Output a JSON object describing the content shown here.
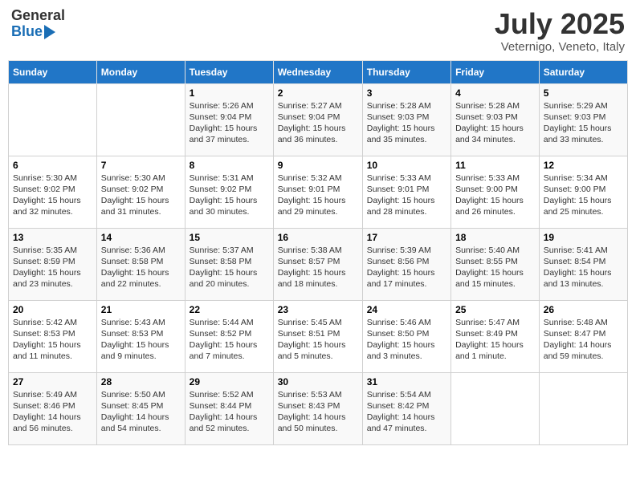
{
  "header": {
    "logo_general": "General",
    "logo_blue": "Blue",
    "month": "July 2025",
    "location": "Veternigo, Veneto, Italy"
  },
  "days_of_week": [
    "Sunday",
    "Monday",
    "Tuesday",
    "Wednesday",
    "Thursday",
    "Friday",
    "Saturday"
  ],
  "weeks": [
    [
      {
        "day": "",
        "info": ""
      },
      {
        "day": "",
        "info": ""
      },
      {
        "day": "1",
        "sunrise": "Sunrise: 5:26 AM",
        "sunset": "Sunset: 9:04 PM",
        "daylight": "Daylight: 15 hours and 37 minutes."
      },
      {
        "day": "2",
        "sunrise": "Sunrise: 5:27 AM",
        "sunset": "Sunset: 9:04 PM",
        "daylight": "Daylight: 15 hours and 36 minutes."
      },
      {
        "day": "3",
        "sunrise": "Sunrise: 5:28 AM",
        "sunset": "Sunset: 9:03 PM",
        "daylight": "Daylight: 15 hours and 35 minutes."
      },
      {
        "day": "4",
        "sunrise": "Sunrise: 5:28 AM",
        "sunset": "Sunset: 9:03 PM",
        "daylight": "Daylight: 15 hours and 34 minutes."
      },
      {
        "day": "5",
        "sunrise": "Sunrise: 5:29 AM",
        "sunset": "Sunset: 9:03 PM",
        "daylight": "Daylight: 15 hours and 33 minutes."
      }
    ],
    [
      {
        "day": "6",
        "sunrise": "Sunrise: 5:30 AM",
        "sunset": "Sunset: 9:02 PM",
        "daylight": "Daylight: 15 hours and 32 minutes."
      },
      {
        "day": "7",
        "sunrise": "Sunrise: 5:30 AM",
        "sunset": "Sunset: 9:02 PM",
        "daylight": "Daylight: 15 hours and 31 minutes."
      },
      {
        "day": "8",
        "sunrise": "Sunrise: 5:31 AM",
        "sunset": "Sunset: 9:02 PM",
        "daylight": "Daylight: 15 hours and 30 minutes."
      },
      {
        "day": "9",
        "sunrise": "Sunrise: 5:32 AM",
        "sunset": "Sunset: 9:01 PM",
        "daylight": "Daylight: 15 hours and 29 minutes."
      },
      {
        "day": "10",
        "sunrise": "Sunrise: 5:33 AM",
        "sunset": "Sunset: 9:01 PM",
        "daylight": "Daylight: 15 hours and 28 minutes."
      },
      {
        "day": "11",
        "sunrise": "Sunrise: 5:33 AM",
        "sunset": "Sunset: 9:00 PM",
        "daylight": "Daylight: 15 hours and 26 minutes."
      },
      {
        "day": "12",
        "sunrise": "Sunrise: 5:34 AM",
        "sunset": "Sunset: 9:00 PM",
        "daylight": "Daylight: 15 hours and 25 minutes."
      }
    ],
    [
      {
        "day": "13",
        "sunrise": "Sunrise: 5:35 AM",
        "sunset": "Sunset: 8:59 PM",
        "daylight": "Daylight: 15 hours and 23 minutes."
      },
      {
        "day": "14",
        "sunrise": "Sunrise: 5:36 AM",
        "sunset": "Sunset: 8:58 PM",
        "daylight": "Daylight: 15 hours and 22 minutes."
      },
      {
        "day": "15",
        "sunrise": "Sunrise: 5:37 AM",
        "sunset": "Sunset: 8:58 PM",
        "daylight": "Daylight: 15 hours and 20 minutes."
      },
      {
        "day": "16",
        "sunrise": "Sunrise: 5:38 AM",
        "sunset": "Sunset: 8:57 PM",
        "daylight": "Daylight: 15 hours and 18 minutes."
      },
      {
        "day": "17",
        "sunrise": "Sunrise: 5:39 AM",
        "sunset": "Sunset: 8:56 PM",
        "daylight": "Daylight: 15 hours and 17 minutes."
      },
      {
        "day": "18",
        "sunrise": "Sunrise: 5:40 AM",
        "sunset": "Sunset: 8:55 PM",
        "daylight": "Daylight: 15 hours and 15 minutes."
      },
      {
        "day": "19",
        "sunrise": "Sunrise: 5:41 AM",
        "sunset": "Sunset: 8:54 PM",
        "daylight": "Daylight: 15 hours and 13 minutes."
      }
    ],
    [
      {
        "day": "20",
        "sunrise": "Sunrise: 5:42 AM",
        "sunset": "Sunset: 8:53 PM",
        "daylight": "Daylight: 15 hours and 11 minutes."
      },
      {
        "day": "21",
        "sunrise": "Sunrise: 5:43 AM",
        "sunset": "Sunset: 8:53 PM",
        "daylight": "Daylight: 15 hours and 9 minutes."
      },
      {
        "day": "22",
        "sunrise": "Sunrise: 5:44 AM",
        "sunset": "Sunset: 8:52 PM",
        "daylight": "Daylight: 15 hours and 7 minutes."
      },
      {
        "day": "23",
        "sunrise": "Sunrise: 5:45 AM",
        "sunset": "Sunset: 8:51 PM",
        "daylight": "Daylight: 15 hours and 5 minutes."
      },
      {
        "day": "24",
        "sunrise": "Sunrise: 5:46 AM",
        "sunset": "Sunset: 8:50 PM",
        "daylight": "Daylight: 15 hours and 3 minutes."
      },
      {
        "day": "25",
        "sunrise": "Sunrise: 5:47 AM",
        "sunset": "Sunset: 8:49 PM",
        "daylight": "Daylight: 15 hours and 1 minute."
      },
      {
        "day": "26",
        "sunrise": "Sunrise: 5:48 AM",
        "sunset": "Sunset: 8:47 PM",
        "daylight": "Daylight: 14 hours and 59 minutes."
      }
    ],
    [
      {
        "day": "27",
        "sunrise": "Sunrise: 5:49 AM",
        "sunset": "Sunset: 8:46 PM",
        "daylight": "Daylight: 14 hours and 56 minutes."
      },
      {
        "day": "28",
        "sunrise": "Sunrise: 5:50 AM",
        "sunset": "Sunset: 8:45 PM",
        "daylight": "Daylight: 14 hours and 54 minutes."
      },
      {
        "day": "29",
        "sunrise": "Sunrise: 5:52 AM",
        "sunset": "Sunset: 8:44 PM",
        "daylight": "Daylight: 14 hours and 52 minutes."
      },
      {
        "day": "30",
        "sunrise": "Sunrise: 5:53 AM",
        "sunset": "Sunset: 8:43 PM",
        "daylight": "Daylight: 14 hours and 50 minutes."
      },
      {
        "day": "31",
        "sunrise": "Sunrise: 5:54 AM",
        "sunset": "Sunset: 8:42 PM",
        "daylight": "Daylight: 14 hours and 47 minutes."
      },
      {
        "day": "",
        "info": ""
      },
      {
        "day": "",
        "info": ""
      }
    ]
  ]
}
